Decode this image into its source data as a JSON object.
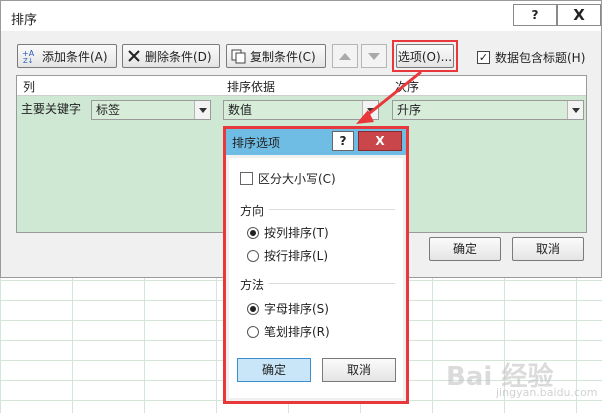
{
  "dialog": {
    "title": "排序",
    "help_label": "?",
    "close_label": "X",
    "toolbar": {
      "add_label": "添加条件(A)",
      "delete_label": "删除条件(D)",
      "copy_label": "复制条件(C)",
      "options_label": "选项(O)...",
      "header_checkbox_label": "数据包含标题(H)",
      "header_checked": true
    },
    "table": {
      "col_headers": [
        "列",
        "排序依据",
        "次序"
      ],
      "rows": [
        {
          "label": "主要关键字",
          "column": "标签",
          "sort_on": "数值",
          "order": "升序"
        }
      ]
    },
    "ok_label": "确定",
    "cancel_label": "取消"
  },
  "options_dialog": {
    "title": "排序选项",
    "help_label": "?",
    "close_label": "X",
    "case_sensitive_label": "区分大小写(C)",
    "case_sensitive": false,
    "orientation_heading": "方向",
    "orientation_options": [
      "按列排序(T)",
      "按行排序(L)"
    ],
    "orientation_selected": 0,
    "method_heading": "方法",
    "method_options": [
      "字母排序(S)",
      "笔划排序(R)"
    ],
    "method_selected": 0,
    "ok_label": "确定",
    "cancel_label": "取消"
  },
  "watermark": {
    "text": "Bai  经验",
    "sub": "jingyan.baidu.com"
  },
  "colors": {
    "highlight": "#e8383c",
    "selection_title": "#6fbde4",
    "sheet_grid": "#d3e6d7"
  }
}
